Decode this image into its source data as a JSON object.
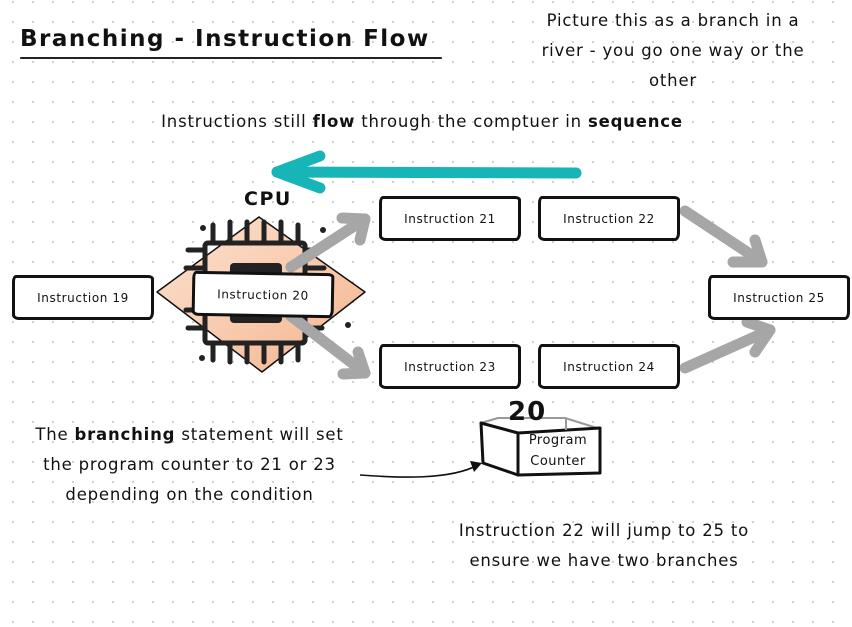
{
  "title": "Branching - Instruction Flow",
  "notes": {
    "river": [
      "Picture this as a branch in a",
      "river - you go one way or the",
      "other"
    ],
    "flow": {
      "prefix": "Instructions still ",
      "bold1": "flow",
      "middle": " through the comptuer in ",
      "bold2": "sequence"
    },
    "branching": {
      "line1_prefix": "The ",
      "line1_bold": "branching",
      "line1_suffix": " statement will set",
      "line2": "the program counter to 21 or 23",
      "line3": "depending on the condition"
    },
    "jump": [
      "Instruction 22 will jump to 25 to",
      "ensure we have two branches"
    ]
  },
  "cpu": {
    "label": "CPU"
  },
  "instructions": [
    {
      "id": 19,
      "label": "Instruction 19"
    },
    {
      "id": 20,
      "label": "Instruction 20"
    },
    {
      "id": 21,
      "label": "Instruction 21"
    },
    {
      "id": 22,
      "label": "Instruction 22"
    },
    {
      "id": 23,
      "label": "Instruction 23"
    },
    {
      "id": 24,
      "label": "Instruction 24"
    },
    {
      "id": 25,
      "label": "Instruction 25"
    }
  ],
  "program_counter": {
    "value": "20",
    "label_line1": "Program",
    "label_line2": "Counter"
  },
  "colors": {
    "flow_arrow": "#17b5b8",
    "branch_arrow": "#a6a6a6",
    "cpu_fill": "#f7c8a8",
    "ink": "#111111"
  }
}
